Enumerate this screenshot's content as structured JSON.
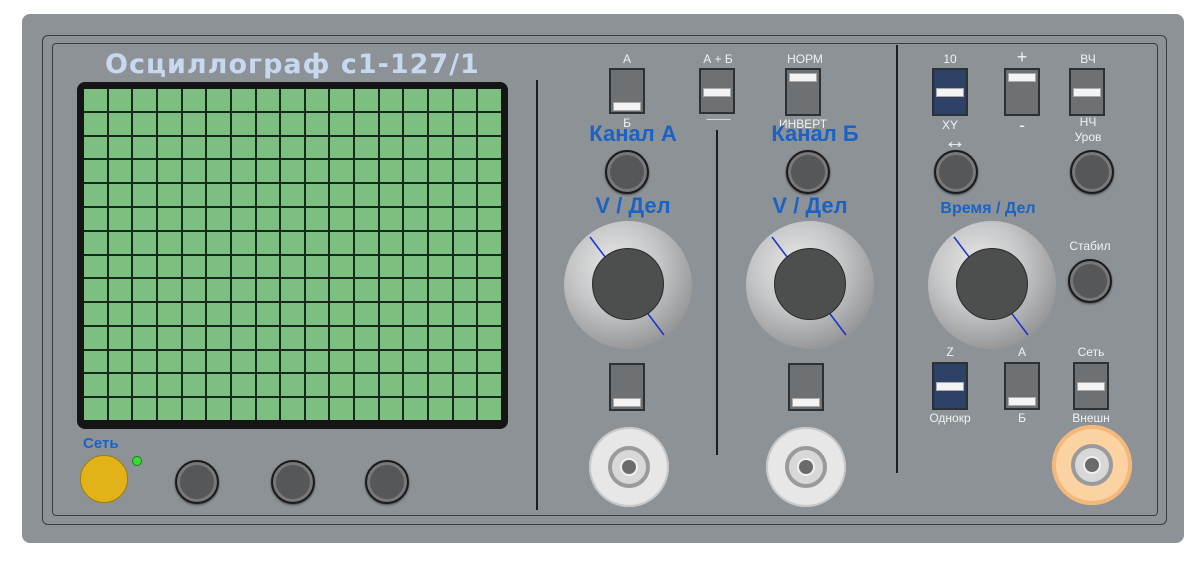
{
  "title": "Осциллограф с1-127/1",
  "power": {
    "label": "Сеть"
  },
  "switches": {
    "a_b": {
      "top": "А",
      "bottom": "Б"
    },
    "a_plus_b": {
      "top": "А + Б",
      "bottom": "------------"
    },
    "norm_invert": {
      "top": "НОРМ",
      "bottom": "ИНВЕРТ"
    },
    "ten_xy": {
      "top": "10",
      "bottom": "XY"
    },
    "plus_minus": {
      "top": "+",
      "bottom": "-"
    },
    "hf_lf": {
      "top": "ВЧ",
      "bottom": "НЧ"
    },
    "z_single": {
      "top": "Z",
      "bottom": "Однокр"
    },
    "trig_a_b": {
      "top": "А",
      "bottom": "Б"
    },
    "net_ext": {
      "top": "Сеть",
      "bottom": "Внешн"
    }
  },
  "channel_a": {
    "title": "Канал А",
    "vdiv": "V / Дел"
  },
  "channel_b": {
    "title": "Канал Б",
    "vdiv": "V / Дел"
  },
  "sweep": {
    "horizontal_symbol": "↔",
    "level_label": "Уров",
    "time_div": "Время / Дел",
    "stability_label": "Стабил"
  },
  "colors": {
    "case": "#8c9296",
    "screen_grid": "#7dbf80",
    "label_blue": "#1a63c4",
    "title": "#c8d8f0",
    "power_button": "#e2b318",
    "power_led": "#34e034"
  }
}
